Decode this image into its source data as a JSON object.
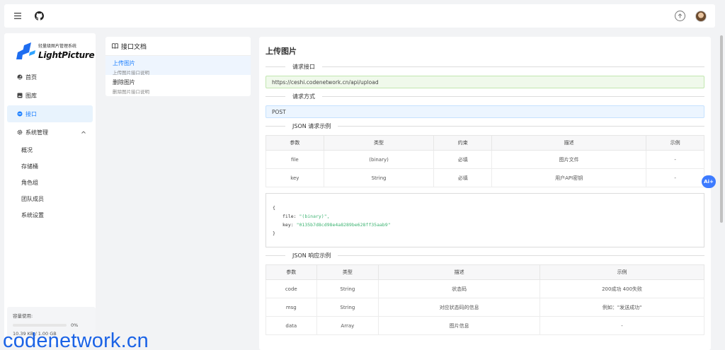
{
  "topbar": {
    "menu_icon": "hamburger-icon",
    "github_icon": "github-icon",
    "upload_icon": "upload-arrow-icon",
    "avatar_icon": "user-avatar"
  },
  "sidebar": {
    "logo_sub": "轻量级图片管理系统",
    "logo_main": "LightPicture",
    "items": [
      {
        "label": "首页",
        "icon": "dashboard-icon"
      },
      {
        "label": "图库",
        "icon": "gallery-icon"
      },
      {
        "label": "接口",
        "icon": "api-icon",
        "active": true
      },
      {
        "label": "系统管理",
        "icon": "gear-icon",
        "expanded": true
      }
    ],
    "sub_items": [
      "概况",
      "存储桶",
      "角色组",
      "团队成员",
      "系统设置"
    ],
    "capacity": {
      "label": "容量使用:",
      "percent": "0%",
      "values": "10.39 KB / 1.00 GB"
    }
  },
  "doclist": {
    "title": "接口文档",
    "items": [
      {
        "title": "上传图片",
        "desc": "上传图片接口说明",
        "active": true
      },
      {
        "title": "删除图片",
        "desc": "删除图片接口说明"
      }
    ]
  },
  "main": {
    "title": "上传图片",
    "sec_endpoint": "请求接口",
    "endpoint": "https://ceshi.codenetwork.cn/api/upload",
    "sec_method": "请求方式",
    "method": "POST",
    "sec_req_example": "JSON 请求示例",
    "req_table": {
      "headers": [
        "参数",
        "类型",
        "约束",
        "描述",
        "示例"
      ],
      "rows": [
        [
          "file",
          "(binary)",
          "必填",
          "图片文件",
          "-"
        ],
        [
          "key",
          "String",
          "必填",
          "用户API密钥",
          "-"
        ]
      ]
    },
    "code": {
      "open": "{",
      "file_key": "file:",
      "file_val": "\"(binary)\",",
      "key_key": "key:",
      "key_val": "\"0135b7d8cd98e4a8289be628ff35aab9\"",
      "close": "}"
    },
    "sec_resp_example": "JSON 响应示例",
    "resp_table": {
      "headers": [
        "参数",
        "类型",
        "描述",
        "示例"
      ],
      "rows": [
        [
          "code",
          "String",
          "状态码",
          "200成功 400失败"
        ],
        [
          "msg",
          "String",
          "对应状态码的信息",
          "例如：\"发送成功\""
        ],
        [
          "data",
          "Array",
          "图片信息",
          "-"
        ]
      ]
    }
  },
  "ai_button": "Ai+",
  "watermark": "codenetwork.cn"
}
